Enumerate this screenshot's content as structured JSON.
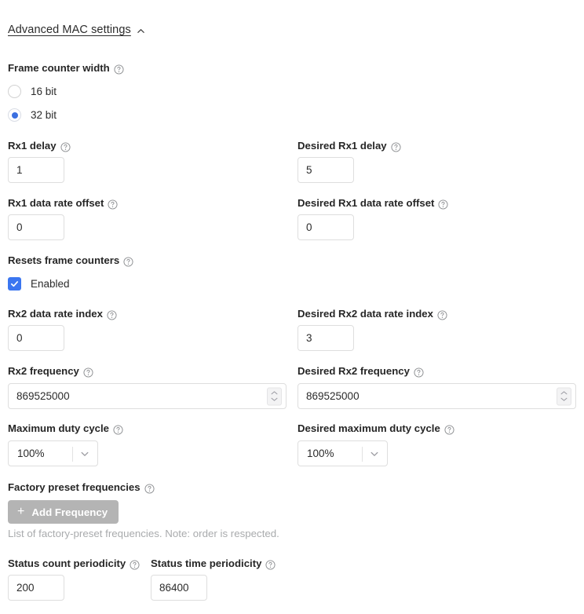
{
  "section": {
    "title": "Advanced MAC settings",
    "collapse_icon": "chevron-up-icon",
    "expanded": true
  },
  "help_icon": "help-circle-icon",
  "accent_colors": {
    "radio_selected": "#3b6fe0",
    "checkbox": "#3b76f0",
    "button_disabled": "#b4b4b4",
    "border": "#dedede",
    "hint_text": "#a9abad",
    "label_text": "#262626"
  },
  "fields": {
    "frame_counter_width": {
      "label": "Frame counter width",
      "options": [
        {
          "label": "16 bit",
          "selected": false
        },
        {
          "label": "32 bit",
          "selected": true
        }
      ]
    },
    "rx1_delay": {
      "label": "Rx1 delay",
      "value": "1"
    },
    "desired_rx1_delay": {
      "label": "Desired Rx1 delay",
      "value": "5"
    },
    "rx1_data_rate_offset": {
      "label": "Rx1 data rate offset",
      "value": "0"
    },
    "desired_rx1_data_rate_offset": {
      "label": "Desired Rx1 data rate offset",
      "value": "0"
    },
    "resets_frame_counters": {
      "label": "Resets frame counters",
      "checkbox_label": "Enabled",
      "checked": true
    },
    "rx2_data_rate_index": {
      "label": "Rx2 data rate index",
      "value": "0"
    },
    "desired_rx2_data_rate_index": {
      "label": "Desired Rx2 data rate index",
      "value": "3"
    },
    "rx2_frequency": {
      "label": "Rx2 frequency",
      "value": "869525000"
    },
    "desired_rx2_frequency": {
      "label": "Desired Rx2 frequency",
      "value": "869525000"
    },
    "maximum_duty_cycle": {
      "label": "Maximum duty cycle",
      "value": "100%",
      "caret_icon": "chevron-down-icon"
    },
    "desired_maximum_duty_cycle": {
      "label": "Desired maximum duty cycle",
      "value": "100%",
      "caret_icon": "chevron-down-icon"
    },
    "factory_preset_frequencies": {
      "label": "Factory preset frequencies",
      "button_label": "Add Frequency",
      "button_icon": "plus-icon",
      "hint": "List of factory-preset frequencies. Note: order is respected."
    },
    "status_count_periodicity": {
      "label": "Status count periodicity",
      "value": "200"
    },
    "status_time_periodicity": {
      "label": "Status time periodicity",
      "value": "86400"
    }
  }
}
